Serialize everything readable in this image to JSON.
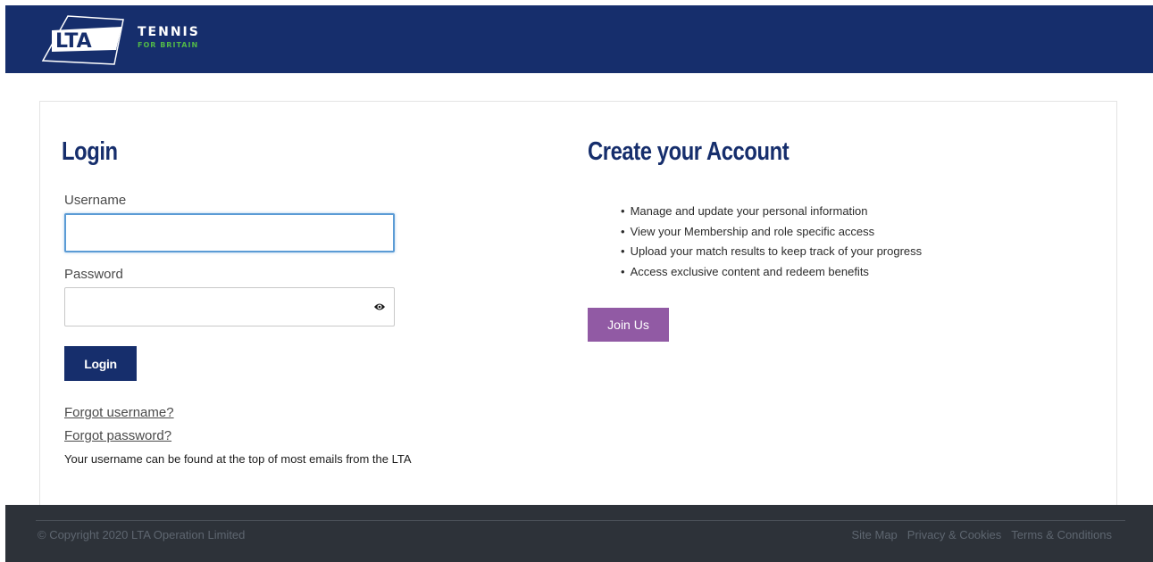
{
  "header": {
    "logo_main": "TENNIS",
    "logo_sub": "FOR BRITAIN",
    "logo_mark_text": "LTA",
    "bg_color": "#162e6c"
  },
  "login": {
    "title": "Login",
    "username_label": "Username",
    "username_value": "",
    "password_label": "Password",
    "password_value": "",
    "button_label": "Login",
    "forgot_username": "Forgot username?",
    "forgot_password": "Forgot password?",
    "hint": "Your username can be found at the top of most emails from the LTA",
    "show_password_icon": "eye-icon"
  },
  "create": {
    "title": "Create your Account",
    "benefits": [
      "Manage and update your personal information",
      "View your Membership and role specific access",
      "Upload your match results to keep track of your progress",
      "Access exclusive content and redeem benefits"
    ],
    "button_label": "Join Us",
    "button_color": "#915aa4"
  },
  "footer": {
    "copyright": "© Copyright 2020 LTA Operation Limited",
    "links": [
      "Site Map",
      "Privacy & Cookies",
      "Terms & Conditions"
    ]
  }
}
